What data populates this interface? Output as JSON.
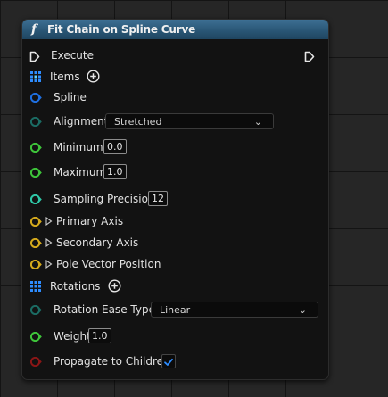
{
  "node": {
    "title": "Fit Chain on Spline Curve",
    "function_glyph": "f"
  },
  "pins": {
    "execute": {
      "label": "Execute"
    },
    "items": {
      "label": "Items"
    },
    "spline": {
      "label": "Spline"
    },
    "alignment": {
      "label": "Alignment",
      "value": "Stretched"
    },
    "minimum": {
      "label": "Minimum",
      "value": "0.0"
    },
    "maximum": {
      "label": "Maximum",
      "value": "1.0"
    },
    "sampling_precision": {
      "label": "Sampling Precision",
      "value": "12"
    },
    "primary_axis": {
      "label": "Primary Axis"
    },
    "secondary_axis": {
      "label": "Secondary Axis"
    },
    "pole_vector_position": {
      "label": "Pole Vector Position"
    },
    "rotations": {
      "label": "Rotations"
    },
    "rotation_ease_type": {
      "label": "Rotation Ease Type",
      "value": "Linear"
    },
    "weight": {
      "label": "Weight",
      "value": "1.0"
    },
    "propagate_to_children": {
      "label": "Propagate to Children",
      "checked": true
    }
  },
  "colors": {
    "header_top": "#3d6f93",
    "header_bottom": "#1f4560",
    "spline_pin": "#1f6fe0",
    "enum_pin": "#1b6b63",
    "float_pin": "#3ec43a",
    "int_pin": "#2fc7a7",
    "struct_pin": "#d4a91c",
    "collection_pin": "#2d8cff",
    "bool_pin": "#8a1616",
    "check_color": "#2d8cff"
  }
}
